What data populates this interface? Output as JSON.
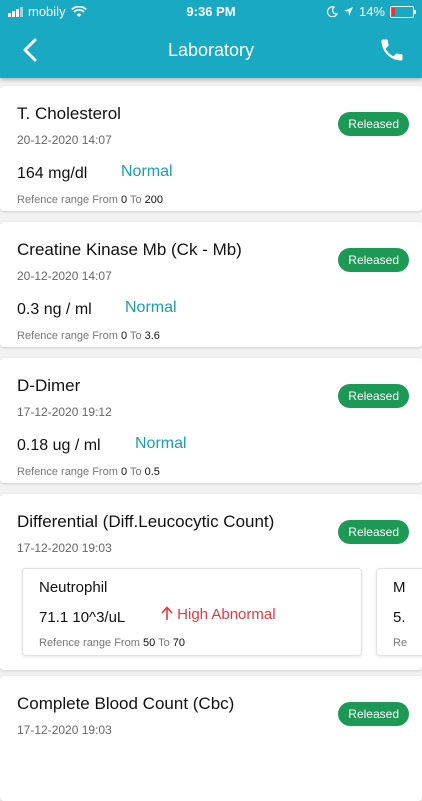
{
  "status_bar": {
    "carrier": "mobily",
    "time": "9:36 PM",
    "battery": "14%"
  },
  "header": {
    "title": "Laboratory"
  },
  "labels": {
    "range_prefix": "Refence range From",
    "range_to": "To"
  },
  "tests": [
    {
      "name": "T. Cholesterol",
      "date": "20-12-2020 14:07",
      "status": "Released",
      "value": "164 mg/dl",
      "result": "Normal",
      "range_from": "0",
      "range_to": "200"
    },
    {
      "name": "Creatine Kinase Mb (Ck - Mb)",
      "date": "20-12-2020 14:07",
      "status": "Released",
      "value": "0.3 ng / ml",
      "result": "Normal",
      "range_from": "0",
      "range_to": "3.6"
    },
    {
      "name": "D-Dimer",
      "date": "17-12-2020 19:12",
      "status": "Released",
      "value": "0.18 ug / ml",
      "result": "Normal",
      "range_from": "0",
      "range_to": "0.5"
    },
    {
      "name": "Differential (Diff.Leucocytic Count)",
      "date": "17-12-2020 19:03",
      "status": "Released",
      "components": [
        {
          "name": "Neutrophil",
          "value": "71.1 10^3/uL",
          "result": "High Abnormal",
          "range_from": "50",
          "range_to": "70"
        },
        {
          "name": "M",
          "value": "5.",
          "range_prefix": "Re"
        }
      ]
    },
    {
      "name": "Complete Blood Count (Cbc)",
      "date": "17-12-2020 19:03",
      "status": "Released"
    }
  ]
}
